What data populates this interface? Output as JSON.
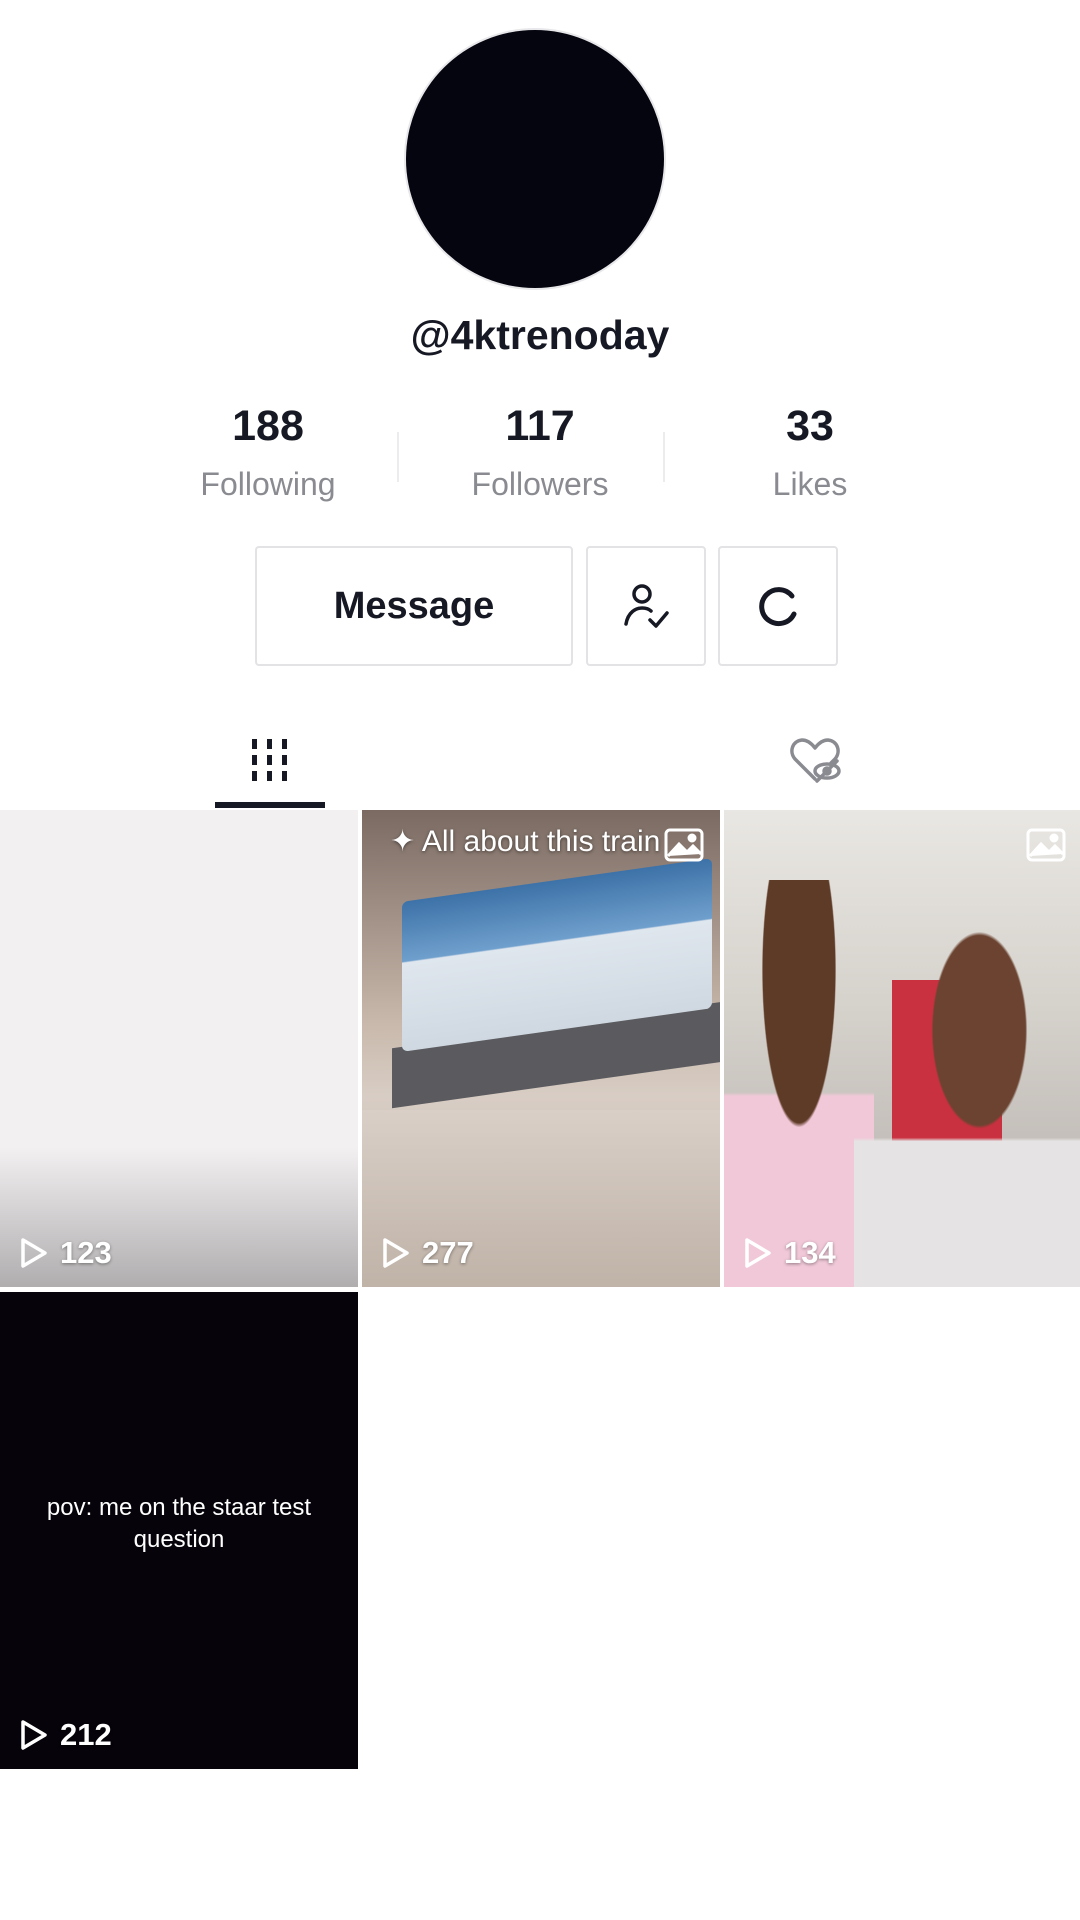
{
  "profile": {
    "username": "@4ktrenoday",
    "stats": {
      "following": {
        "value": "188",
        "label": "Following"
      },
      "followers": {
        "value": "117",
        "label": "Followers"
      },
      "likes": {
        "value": "33",
        "label": "Likes"
      }
    }
  },
  "actions": {
    "message_label": "Message",
    "follow_icon": "person-check-icon",
    "refresh_icon": "refresh-icon"
  },
  "tabs": {
    "videos_icon": "grid-icon",
    "liked_icon": "liked-hidden-icon"
  },
  "videos": [
    {
      "views": "123",
      "caption": ""
    },
    {
      "views": "277",
      "caption": "All about this train"
    },
    {
      "views": "134",
      "caption": ""
    },
    {
      "views": "212",
      "caption": "pov: me on the staar test question"
    }
  ],
  "colors": {
    "text": "#161823",
    "muted": "#8a8b91",
    "border": "#e3e3e6"
  }
}
